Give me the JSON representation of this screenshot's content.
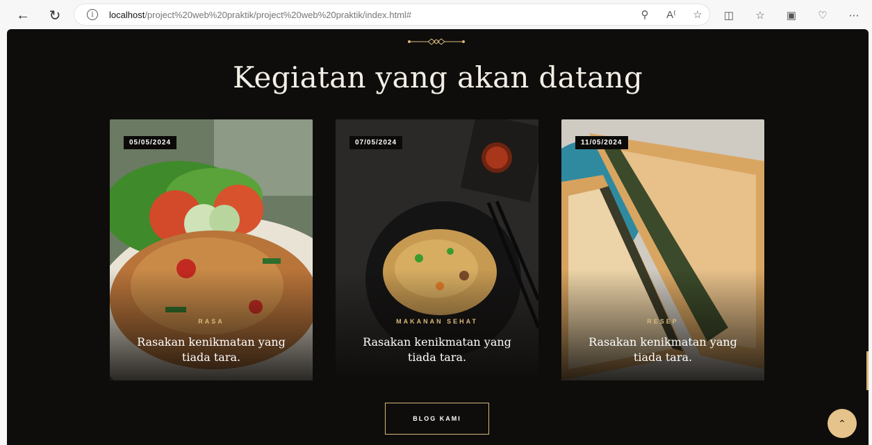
{
  "browser": {
    "url_host": "localhost",
    "url_path": "/project%20web%20praktik/project%20web%20praktik/index.html#",
    "icons": {
      "back": "back-arrow-icon",
      "refresh": "refresh-icon",
      "info": "info-icon",
      "zoom": "zoom-out-icon",
      "read_aloud": "read-aloud-icon",
      "favorite": "star-icon",
      "split": "split-screen-icon",
      "favorites_bar": "favorites-icon",
      "collections": "collections-icon",
      "health": "browser-essentials-icon",
      "more": "more-icon"
    }
  },
  "section": {
    "title": "Kegiatan yang akan datang"
  },
  "cards": [
    {
      "date": "05/05/2024",
      "tag": "RASA",
      "caption": "Rasakan kenikmatan yang tiada tara."
    },
    {
      "date": "07/05/2024",
      "tag": "MAKANAN SEHAT",
      "caption": "Rasakan kenikmatan yang tiada tara."
    },
    {
      "date": "11/05/2024",
      "tag": "RESEP",
      "caption": "Rasakan kenikmatan yang tiada tara."
    }
  ],
  "blog_button": "BLOG KAMI",
  "colors": {
    "background": "#0e0d0c",
    "accent": "#d9b97a",
    "scroll_button": "#e6c38a"
  }
}
